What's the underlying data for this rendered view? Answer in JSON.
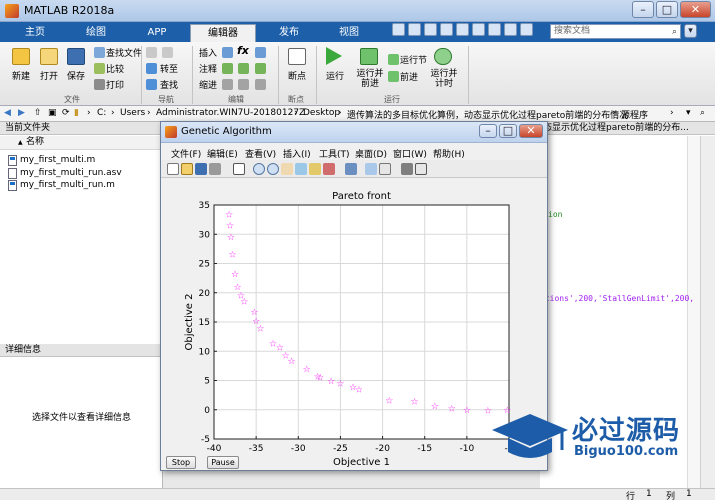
{
  "window": {
    "title": "MATLAB R2018a",
    "minimize": "–",
    "maximize": "□",
    "close": "✕"
  },
  "ribbon_tabs": [
    "主页",
    "绘图",
    "APP",
    "编辑器",
    "发布",
    "视图"
  ],
  "search": {
    "placeholder": "搜索文档",
    "icon": "search-icon"
  },
  "ribbon": {
    "file": {
      "new": "新建",
      "open": "打开",
      "save": "保存",
      "find_files": "查找文件",
      "compare": "比较",
      "print": "打印",
      "group": "文件"
    },
    "nav": {
      "goto": "转至",
      "find": "查找",
      "group": "导航"
    },
    "edit": {
      "insert": "插入",
      "fx": "fx",
      "comment": "注释",
      "indent": "缩进",
      "group": "编辑"
    },
    "breakpoints": {
      "label": "断点",
      "group": "断点"
    },
    "run": {
      "run": "运行",
      "run_advance": "运行并\n前进",
      "run_section": "运行节",
      "advance": "前进",
      "run_time": "运行并\n计时",
      "group": "运行"
    }
  },
  "address": {
    "path": [
      "C:",
      "Users",
      "Administrator.WIN7U-20180127Z",
      "Desktop",
      "遗传算法的多目标优化算例，动态显示优化过程pareto前端的分布情况",
      "源程序"
    ],
    "separator": "›"
  },
  "left_panel": {
    "header": "当前文件夹",
    "column": "名称",
    "sort_icon": "▲",
    "files": [
      "my_first_multi.m",
      "my_first_multi_run.asv",
      "my_first_multi_run.m"
    ],
    "details_header": "详细信息",
    "details_text": "选择文件以查看详细信息"
  },
  "editor": {
    "tab": "态显示优化过程pareto前端的分布...",
    "code_lines": [
      "ion",
      "ations',200,'StallGenLimit',200,"
    ]
  },
  "figure": {
    "title": "Genetic Algorithm",
    "menu": [
      "文件(F)",
      "编辑(E)",
      "查看(V)",
      "插入(I)",
      "工具(T)",
      "桌面(D)",
      "窗口(W)",
      "帮助(H)"
    ],
    "stop_label": "Stop",
    "pause_label": "Pause"
  },
  "chart_data": {
    "type": "scatter",
    "title": "Pareto front",
    "xlabel": "Objective 1",
    "ylabel": "Objective 2",
    "xlim": [
      -40,
      -5
    ],
    "ylim": [
      -5,
      35
    ],
    "xticks": [
      -40,
      -35,
      -30,
      -25,
      -20,
      -15,
      -10,
      -5
    ],
    "yticks": [
      -5,
      0,
      5,
      10,
      15,
      20,
      25,
      30,
      35
    ],
    "grid": true,
    "marker": "star",
    "color": "#ff00ff",
    "points": [
      [
        -38.2,
        33.4
      ],
      [
        -38.1,
        31.5
      ],
      [
        -38.0,
        29.5
      ],
      [
        -37.8,
        26.5
      ],
      [
        -37.5,
        23.2
      ],
      [
        -37.2,
        21.0
      ],
      [
        -36.8,
        19.5
      ],
      [
        -36.4,
        18.5
      ],
      [
        -35.2,
        16.7
      ],
      [
        -35.0,
        15.2
      ],
      [
        -34.5,
        13.9
      ],
      [
        -33.0,
        11.3
      ],
      [
        -32.2,
        10.6
      ],
      [
        -31.5,
        9.3
      ],
      [
        -30.8,
        8.3
      ],
      [
        -29.0,
        7.0
      ],
      [
        -27.7,
        5.7
      ],
      [
        -27.4,
        5.5
      ],
      [
        -26.1,
        4.9
      ],
      [
        -25.0,
        4.5
      ],
      [
        -23.5,
        3.9
      ],
      [
        -22.8,
        3.5
      ],
      [
        -19.2,
        1.6
      ],
      [
        -16.2,
        1.4
      ],
      [
        -13.8,
        0.6
      ],
      [
        -11.8,
        0.2
      ],
      [
        -10.0,
        0.0
      ],
      [
        -7.5,
        -0.1
      ],
      [
        -5.2,
        0.0
      ]
    ]
  },
  "statusbar": {
    "row_label": "行",
    "row": "1",
    "col_label": "列",
    "col": "1"
  },
  "watermark": {
    "text": "必过源码",
    "url": "Biguo100.com"
  }
}
